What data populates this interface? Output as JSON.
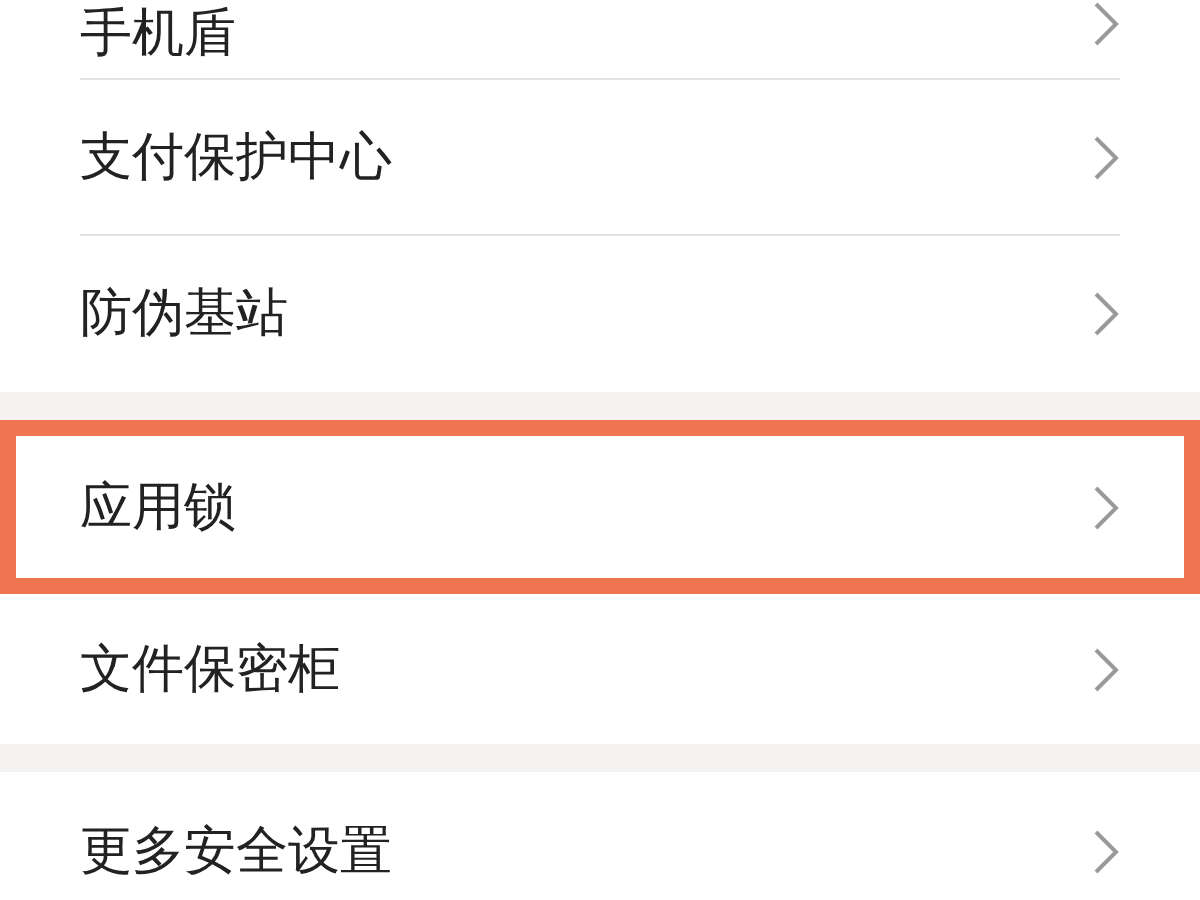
{
  "sections": [
    {
      "items": [
        {
          "label": "手机盾",
          "highlighted": false
        },
        {
          "label": "支付保护中心",
          "highlighted": false
        },
        {
          "label": "防伪基站",
          "highlighted": false
        }
      ]
    },
    {
      "items": [
        {
          "label": "应用锁",
          "highlighted": true
        },
        {
          "label": "文件保密柜",
          "highlighted": false
        }
      ]
    },
    {
      "items": [
        {
          "label": "更多安全设置",
          "highlighted": false
        }
      ]
    }
  ]
}
